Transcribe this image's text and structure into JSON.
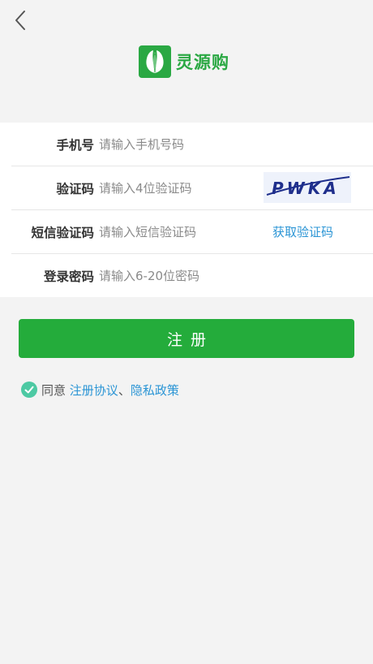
{
  "header": {
    "back_icon": "chevron-left-icon",
    "app_name": "灵源购",
    "logo_icon": "cabbage-logo-icon"
  },
  "colors": {
    "brand_green": "#2aa843",
    "button_green": "#24ac3b",
    "link_blue": "#2b95d5",
    "check_teal": "#4dc9a3"
  },
  "form": {
    "phone": {
      "label": "手机号",
      "placeholder": "请输入手机号码",
      "value": ""
    },
    "captcha": {
      "label": "验证码",
      "placeholder": "请输入4位验证码",
      "value": "",
      "image_text": "PWKA"
    },
    "sms": {
      "label": "短信验证码",
      "placeholder": "请输入短信验证码",
      "value": "",
      "button": "获取验证码"
    },
    "password": {
      "label": "登录密码",
      "placeholder": "请输入6-20位密码",
      "value": ""
    }
  },
  "register_button": "注册",
  "agreement": {
    "checked": true,
    "prefix": "同意",
    "terms_link": "注册协议",
    "separator": "、",
    "privacy_link": "隐私政策"
  }
}
